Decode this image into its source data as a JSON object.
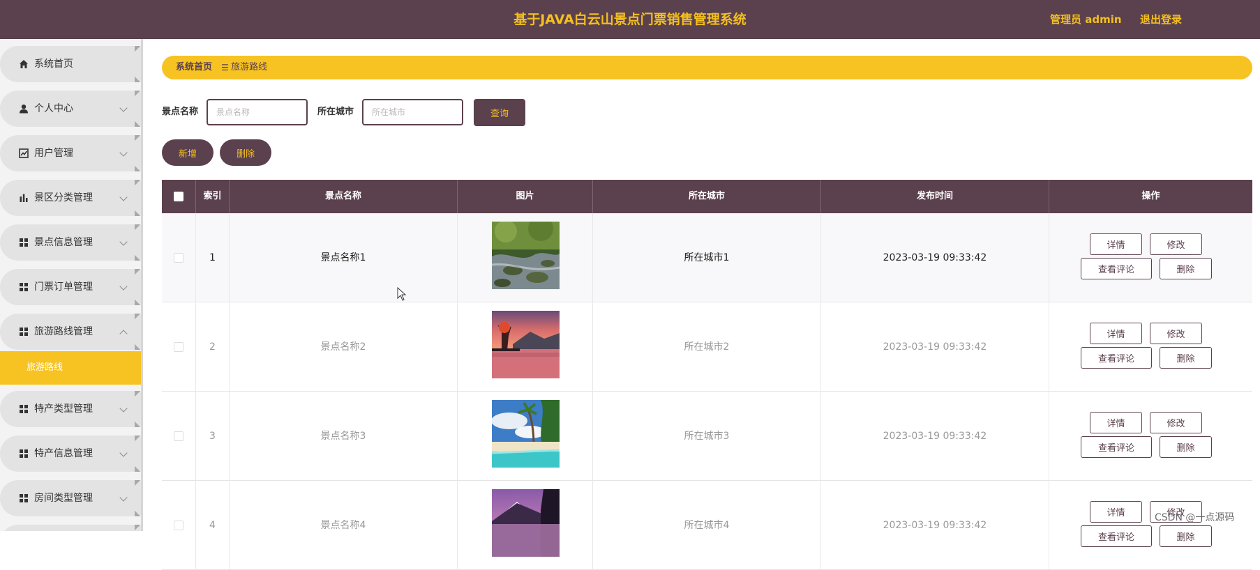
{
  "header": {
    "title": "基于JAVA白云山景点门票销售管理系统",
    "admin_label": "管理员 admin",
    "logout_label": "退出登录"
  },
  "sidebar": {
    "items": [
      {
        "label": "系统首页",
        "icon": "home-icon"
      },
      {
        "label": "个人中心",
        "icon": "user-icon"
      },
      {
        "label": "用户管理",
        "icon": "trend-chart-icon"
      },
      {
        "label": "景区分类管理",
        "icon": "bar-chart-icon"
      },
      {
        "label": "景点信息管理",
        "icon": "grid-icon"
      },
      {
        "label": "门票订单管理",
        "icon": "grid-icon"
      },
      {
        "label": "旅游路线管理",
        "icon": "grid-icon"
      },
      {
        "label": "特产类型管理",
        "icon": "grid-icon"
      },
      {
        "label": "特产信息管理",
        "icon": "grid-icon"
      },
      {
        "label": "房间类型管理",
        "icon": "grid-icon"
      }
    ],
    "active_sub": "旅游路线"
  },
  "breadcrumb": {
    "home": "系统首页",
    "separator": "☰",
    "current": "旅游路线"
  },
  "search": {
    "name_label": "景点名称",
    "name_placeholder": "景点名称",
    "city_label": "所在城市",
    "city_placeholder": "所在城市",
    "query_label": "查询"
  },
  "actions": {
    "add_label": "新增",
    "delete_label": "删除"
  },
  "table": {
    "columns": [
      "索引",
      "景点名称",
      "图片",
      "所在城市",
      "发布时间",
      "操作"
    ],
    "rows": [
      {
        "index": "1",
        "name": "景点名称1",
        "city": "所在城市1",
        "time": "2023-03-19 09:33:42",
        "image": "stream-forest"
      },
      {
        "index": "2",
        "name": "景点名称2",
        "city": "所在城市2",
        "time": "2023-03-19 09:33:42",
        "image": "sunset-lake"
      },
      {
        "index": "3",
        "name": "景点名称3",
        "city": "所在城市3",
        "time": "2023-03-19 09:33:42",
        "image": "tropical-beach"
      },
      {
        "index": "4",
        "name": "景点名称4",
        "city": "所在城市4",
        "time": "2023-03-19 09:33:42",
        "image": "mountain-lake"
      }
    ],
    "row_actions": {
      "detail": "详情",
      "edit": "修改",
      "comments": "查看评论",
      "delete": "删除"
    }
  },
  "watermark": "CSDN @一点源码",
  "colors": {
    "primary": "#5b404d",
    "accent": "#f3c01f"
  }
}
